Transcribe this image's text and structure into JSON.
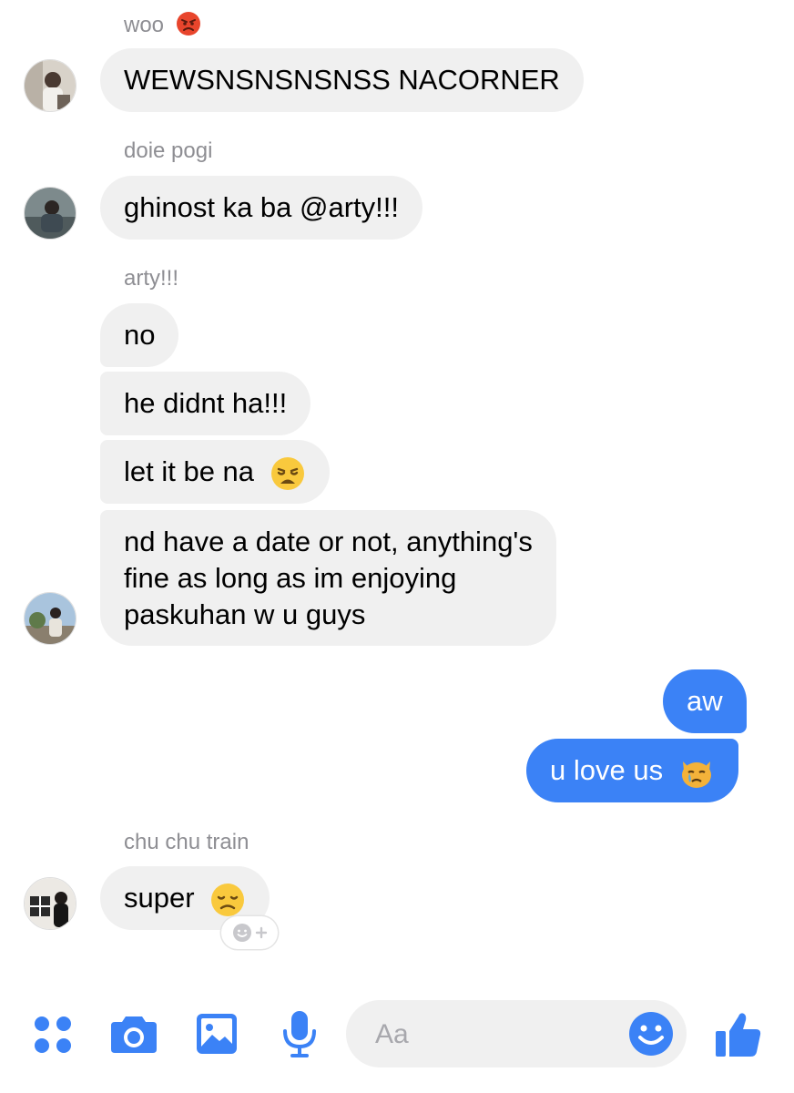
{
  "thread": [
    {
      "sender": "woo",
      "sender_emoji": "angry-face",
      "messages": [
        "WEWSNSNSNSNSS NACORNER"
      ]
    },
    {
      "sender": "doie pogi",
      "messages": [
        "ghinost ka ba @arty!!!"
      ]
    },
    {
      "sender": "arty!!!",
      "messages": [
        "no",
        "he didnt ha!!!",
        "let it be na",
        "nd have a date or not, anything's",
        "fine as long as im enjoying",
        "paskuhan w u guys"
      ],
      "emojis": {
        "let it be na": "weary-face"
      }
    },
    {
      "sender": "me",
      "messages": [
        "aw",
        "u love us"
      ],
      "emojis": {
        "u love us": "crying-cat-face"
      }
    },
    {
      "sender": "chu chu train",
      "messages": [
        "super"
      ],
      "emojis": {
        "super": "disappointed-face"
      }
    }
  ],
  "composer": {
    "placeholder": "Aa"
  },
  "colors": {
    "accent": "#3b82f6",
    "incoming_bubble": "#f0f0f0",
    "sender_label": "#8e8e93"
  }
}
